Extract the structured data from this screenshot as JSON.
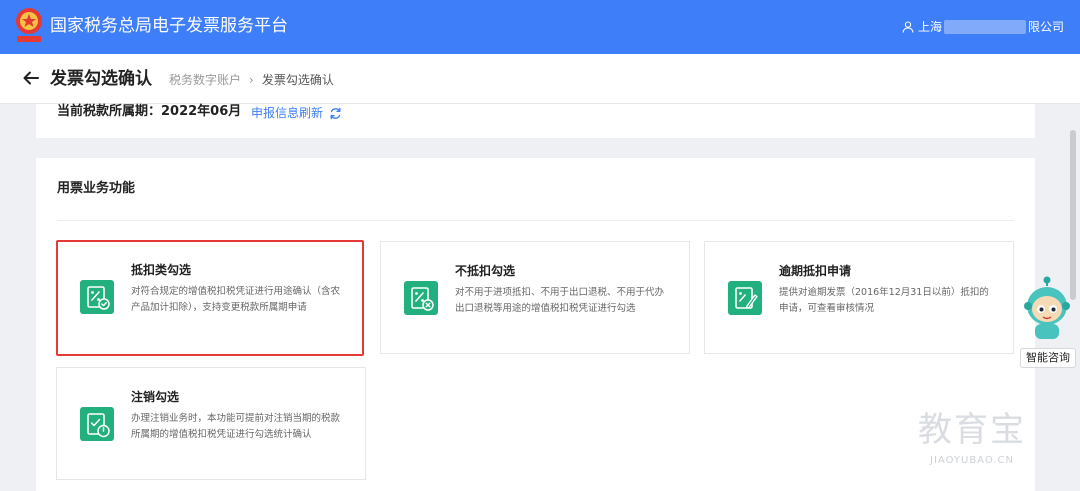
{
  "header": {
    "app_title": "国家税务总局电子发票服务平台",
    "user_prefix": "上海",
    "user_suffix": "限公司"
  },
  "page": {
    "title": "发票勾选确认",
    "breadcrumb": [
      "税务数字账户",
      "发票勾选确认"
    ]
  },
  "period": {
    "label": "当前税款所属期：2022年06月",
    "refresh_label": "申报信息刷新"
  },
  "functions": {
    "section_title": "用票业务功能",
    "tiles": [
      {
        "name": "抵扣类勾选",
        "desc": "对符合规定的增值税扣税凭证进行用途确认（含农产品加计扣除），支持变更税款所属期申请",
        "icon": "deduct-check-icon",
        "selected": true
      },
      {
        "name": "不抵扣勾选",
        "desc": "对不用于进项抵扣、不用于出口退税、不用于代办出口退税等用途的增值税扣税凭证进行勾选",
        "icon": "no-deduct-icon",
        "selected": false
      },
      {
        "name": "逾期抵扣申请",
        "desc": "提供对逾期发票（2016年12月31日以前）抵扣的申请，可查看审核情况",
        "icon": "overdue-edit-icon",
        "selected": false
      },
      {
        "name": "注销勾选",
        "desc": "办理注销业务时，本功能可提前对注销当期的税款所属期的增值税扣税凭证进行勾选统计确认",
        "icon": "cancel-power-icon",
        "selected": false
      }
    ]
  },
  "assistant": {
    "label": "智能咨询"
  },
  "watermark": {
    "big": "教育宝",
    "small": "JIAOYUBAO.CN"
  },
  "colors": {
    "brand_blue": "#3e7ef8",
    "icon_green": "#22b07e",
    "highlight_red": "#e53935"
  }
}
